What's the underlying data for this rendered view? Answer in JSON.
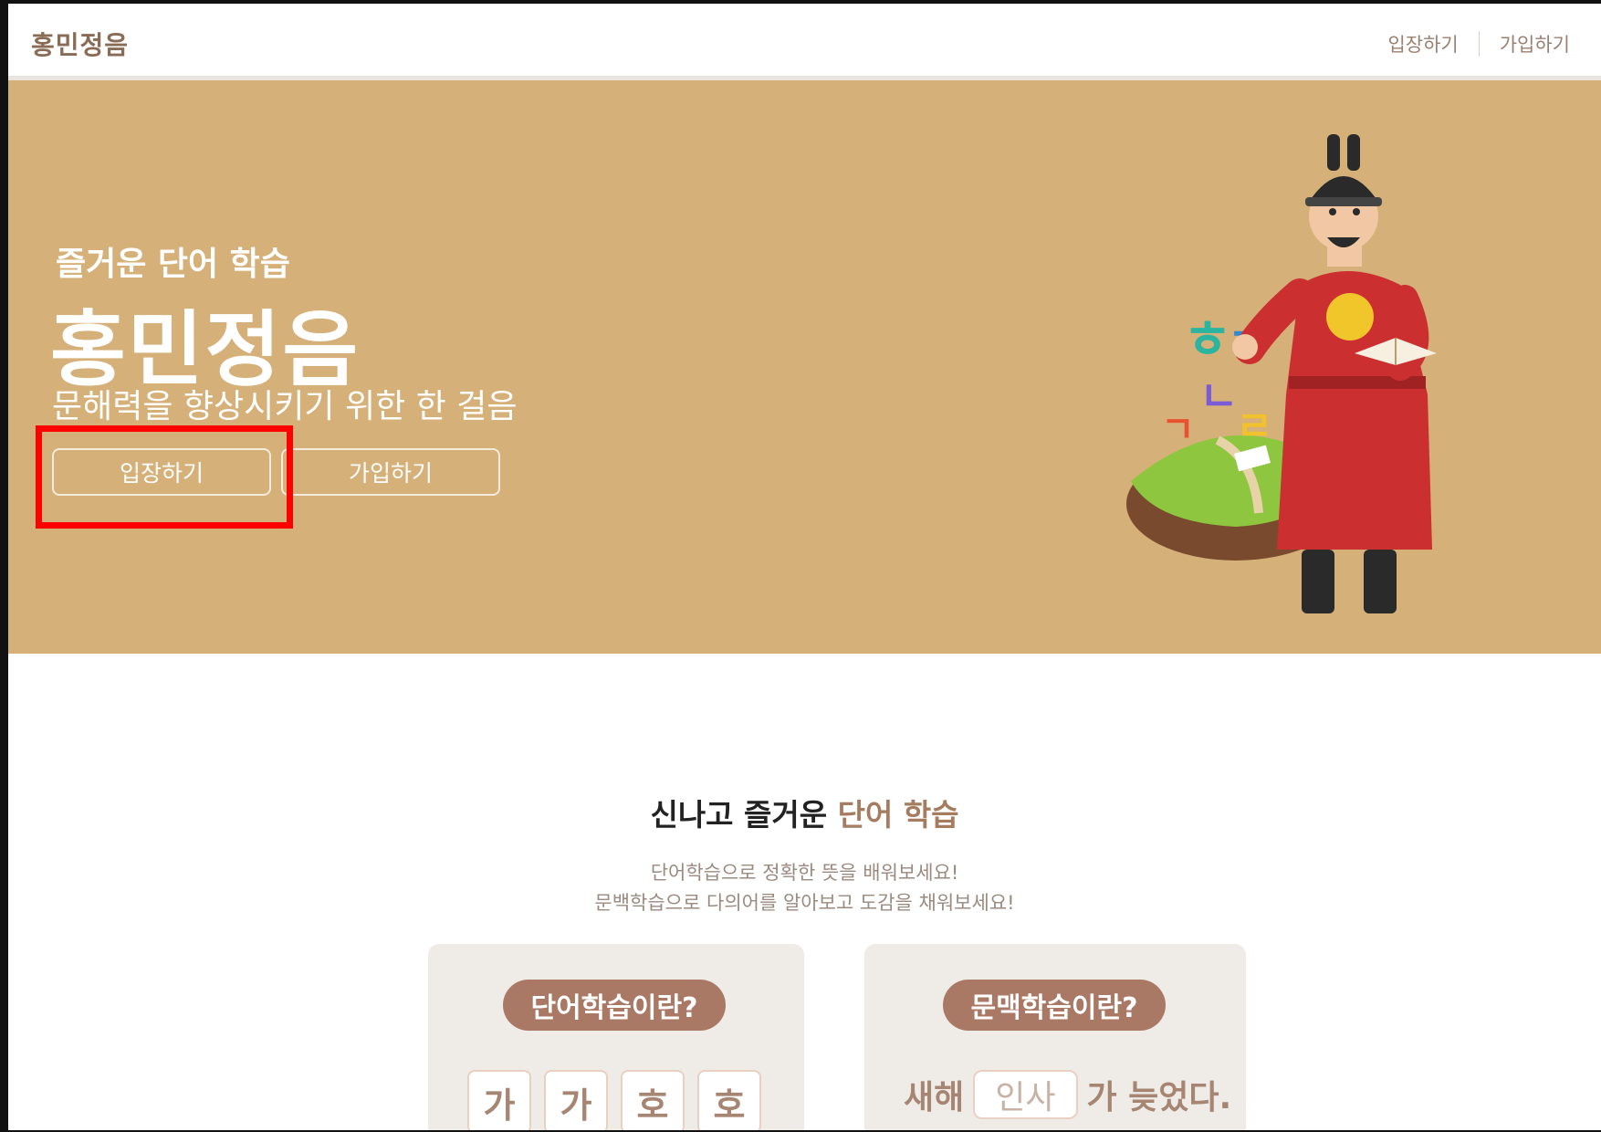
{
  "header": {
    "logo": "홍민정음",
    "nav": {
      "enter": "입장하기",
      "join": "가입하기"
    }
  },
  "hero": {
    "subtitle": "즐거운 단어 학습",
    "title": "홍민정음",
    "description": "문해력을 향상시키기 위한 한 걸음",
    "buttons": {
      "enter": "입장하기",
      "join": "가입하기"
    },
    "background_color": "#d5b078",
    "illustration": "king-sejong-with-book-and-floating-island-hangul"
  },
  "intro": {
    "title_prefix": "신나고 즐거운",
    "title_accent": "단어 학습",
    "desc_line1": "단어학습으로 정확한 뜻을 배워보세요!",
    "desc_line2": "문백학습으로 다의어를 알아보고 도감을 채워보세요!",
    "accent_color": "#a57c5f"
  },
  "cards": {
    "word": {
      "label": "단어학습이란?",
      "tiles": [
        "가",
        "가",
        "호",
        "호"
      ]
    },
    "context": {
      "label": "문맥학습이란?",
      "before": "새해",
      "blank": "인사",
      "after": "가 늦었다."
    },
    "pill_color": "#a97966"
  }
}
